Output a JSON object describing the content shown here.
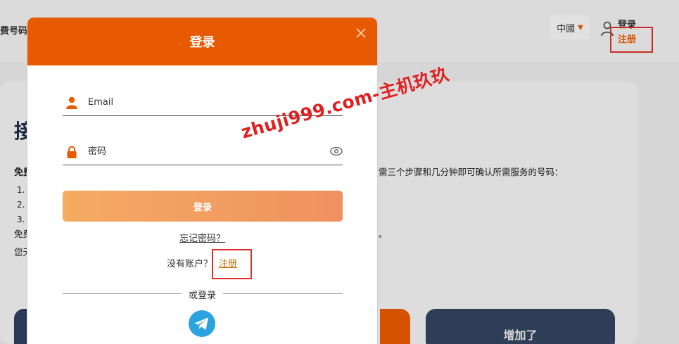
{
  "background": {
    "brand": "费号码",
    "language": "中國",
    "login": "登录",
    "register": "注册",
    "heading": "接",
    "bold_line": "免费",
    "list": [
      "1.",
      "2.",
      "3."
    ],
    "text_right": "需三个步骤和几分钟即可确认所需服务的号码：",
    "text_line_1": "免费",
    "text_line_1_tail": "。",
    "text_line_2": "您无",
    "button_dark": "增加了"
  },
  "modal": {
    "title": "登录",
    "email_placeholder": "Email",
    "password_placeholder": "密码",
    "login_button": "登录",
    "forgot_password": "忘记密码？",
    "no_account": "没有账户？",
    "register_link": "注册",
    "or_login": "或登录"
  },
  "watermark": "zhuji999.com-主机玖玖",
  "colors": {
    "accent": "#e85a00",
    "highlight_box": "#d9312b",
    "telegram": "#2aa3df"
  }
}
